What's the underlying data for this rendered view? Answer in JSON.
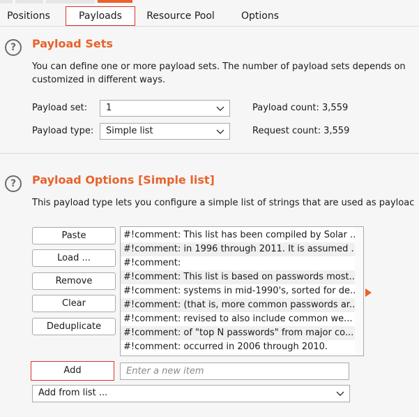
{
  "tabs": {
    "positions": "Positions",
    "payloads": "Payloads",
    "resource_pool": "Resource Pool",
    "options": "Options"
  },
  "payload_sets": {
    "heading": "Payload Sets",
    "description_line1": "You can define one or more payload sets. The number of payload sets depends on",
    "description_line2": "customized in different ways.",
    "set_label": "Payload set:",
    "set_value": "1",
    "type_label": "Payload type:",
    "type_value": "Simple list",
    "payload_count": "Payload count: 3,559",
    "request_count": "Request count: 3,559"
  },
  "payload_options": {
    "heading": "Payload Options [Simple list]",
    "description": "This payload type lets you configure a simple list of strings that are used as payloac",
    "buttons": {
      "paste": "Paste",
      "load": "Load ...",
      "remove": "Remove",
      "clear": "Clear",
      "deduplicate": "Deduplicate",
      "add": "Add"
    },
    "list_items": [
      "#!comment: This list has been compiled by Solar ...",
      "#!comment: in 1996 through 2011.  It is assumed ...",
      "#!comment:",
      "#!comment: This list is based on passwords most...",
      "#!comment: systems in mid-1990's, sorted for de...",
      "#!comment: (that is, more common passwords ar...",
      "#!comment: revised to also include common we...",
      "#!comment: of \"top N passwords\" from major co...",
      "#!comment: occurred in 2006 through 2010."
    ],
    "new_item_placeholder": "Enter a new item",
    "add_from_list": "Add from list ..."
  },
  "colors": {
    "accent": "#e8622b",
    "active_outline": "#e0302a"
  }
}
